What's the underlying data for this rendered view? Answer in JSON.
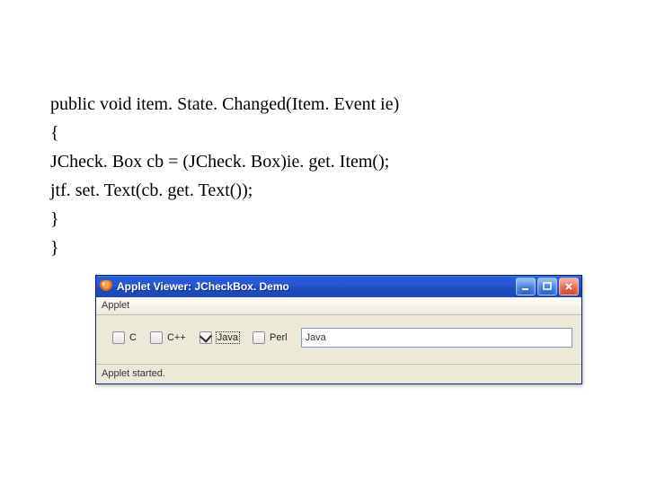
{
  "code": {
    "l1": "public void item. State. Changed(Item. Event ie)",
    "l2": "{",
    "l3": "JCheck. Box cb = (JCheck. Box)ie. get. Item();",
    "l4": "jtf. set. Text(cb. get. Text());",
    "l5": "}",
    "l6": "}"
  },
  "window": {
    "title": "Applet Viewer: JCheckBox. Demo",
    "applet_label": "Applet",
    "checkboxes": [
      {
        "label": "C",
        "checked": false,
        "selected": false
      },
      {
        "label": "C++",
        "checked": false,
        "selected": false
      },
      {
        "label": "Java",
        "checked": true,
        "selected": true
      },
      {
        "label": "Perl",
        "checked": false,
        "selected": false
      }
    ],
    "textfield_value": "Java",
    "status": "Applet started."
  }
}
